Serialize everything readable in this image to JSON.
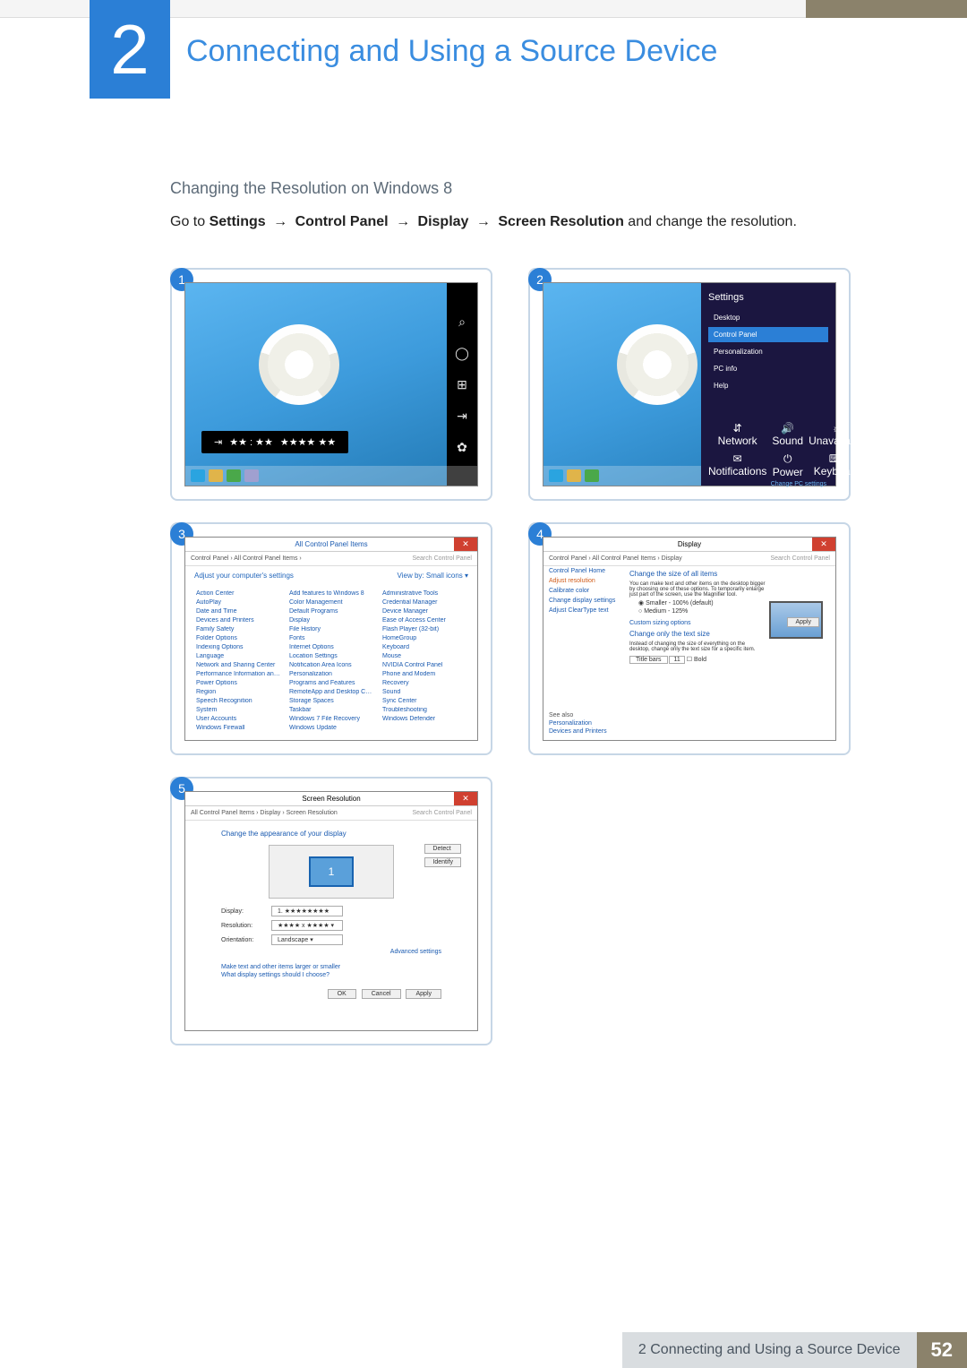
{
  "chapter": {
    "number": "2",
    "title": "Connecting and Using a Source Device"
  },
  "section": {
    "subheading": "Changing the Resolution on Windows 8"
  },
  "instruction": {
    "prefix": "Go to ",
    "p1": "Settings",
    "p2": "Control Panel",
    "p3": "Display",
    "p4": "Screen Resolution",
    "suffix": " and change the resolution.",
    "arrow": "→"
  },
  "steps": {
    "s1": "1",
    "s2": "2",
    "s3": "3",
    "s4": "4",
    "s5": "5"
  },
  "screenshot1": {
    "charms": {
      "search": "⌕",
      "share": "◯",
      "start": "⊞",
      "devices": "⇥",
      "settings": "✿"
    },
    "hint_clock": "★★ : ★★",
    "hint_date": "★★★★  ★★"
  },
  "screenshot2": {
    "panel_title": "Settings",
    "items": {
      "desktop": "Desktop",
      "control_panel": "Control Panel",
      "personalization": "Personalization",
      "pc_info": "PC info",
      "help": "Help"
    },
    "bottom": {
      "network": "Network",
      "sound": "Sound",
      "brightness": "Unavailable",
      "notifications": "Notifications",
      "power": "Power",
      "keyboard": "Keyboard"
    },
    "change_link": "Change PC settings"
  },
  "screenshot3": {
    "title": "All Control Panel Items",
    "breadcrumb": "Control Panel  ›  All Control Panel Items  ›",
    "search_placeholder": "Search Control Panel",
    "adjust": "Adjust your computer's settings",
    "viewby": "View by:   Small icons ▾",
    "items": [
      "Action Center",
      "Add features to Windows 8",
      "Administrative Tools",
      "AutoPlay",
      "Color Management",
      "Credential Manager",
      "Date and Time",
      "Default Programs",
      "Device Manager",
      "Devices and Printers",
      "Display",
      "Ease of Access Center",
      "Family Safety",
      "File History",
      "Flash Player (32-bit)",
      "Folder Options",
      "Fonts",
      "HomeGroup",
      "Indexing Options",
      "Internet Options",
      "Keyboard",
      "Language",
      "Location Settings",
      "Mouse",
      "Network and Sharing Center",
      "Notification Area Icons",
      "NVIDIA Control Panel",
      "Performance Information and Tools",
      "Personalization",
      "Phone and Modem",
      "Power Options",
      "Programs and Features",
      "Recovery",
      "Region",
      "RemoteApp and Desktop Connections",
      "Sound",
      "Speech Recognition",
      "Storage Spaces",
      "Sync Center",
      "System",
      "Taskbar",
      "Troubleshooting",
      "User Accounts",
      "Windows 7 File Recovery",
      "Windows Defender",
      "Windows Firewall",
      "Windows Update",
      ""
    ]
  },
  "screenshot4": {
    "title": "Display",
    "breadcrumb": "Control Panel  ›  All Control Panel Items  ›  Display",
    "search_placeholder": "Search Control Panel",
    "sidebar": {
      "home": "Control Panel Home",
      "adjust_res": "Adjust resolution",
      "calibrate": "Calibrate color",
      "change_settings": "Change display settings",
      "cleartype": "Adjust ClearType text"
    },
    "main": {
      "h1": "Change the size of all items",
      "desc": "You can make text and other items on the desktop bigger by choosing one of these options. To temporarily enlarge just part of the screen, use the Magnifier tool.",
      "opt_small": "Smaller - 100% (default)",
      "opt_medium": "Medium - 125%",
      "custom": "Custom sizing options",
      "h2": "Change only the text size",
      "desc2": "Instead of changing the size of everything on the desktop, change only the text size for a specific item.",
      "dd1": "Title bars",
      "dd2": "11",
      "cb": "Bold",
      "apply": "Apply"
    },
    "seealso": {
      "label": "See also",
      "l1": "Personalization",
      "l2": "Devices and Printers"
    }
  },
  "screenshot5": {
    "title": "Screen Resolution",
    "breadcrumb": "All Control Panel Items  ›  Display  ›  Screen Resolution",
    "search_placeholder": "Search Control Panel",
    "h": "Change the appearance of your display",
    "detect": "Detect",
    "identify": "Identify",
    "monitor_label": "1",
    "display_label": "Display:",
    "display_val": "1. ★★★★★★★★",
    "res_label": "Resolution:",
    "res_val": "★★★★ x ★★★★ ▾",
    "orient_label": "Orientation:",
    "orient_val": "Landscape ▾",
    "adv": "Advanced settings",
    "link1": "Make text and other items larger or smaller",
    "link2": "What display settings should I choose?",
    "ok": "OK",
    "cancel": "Cancel",
    "apply": "Apply"
  },
  "footer": {
    "label": "2 Connecting and Using a Source Device",
    "page": "52"
  }
}
